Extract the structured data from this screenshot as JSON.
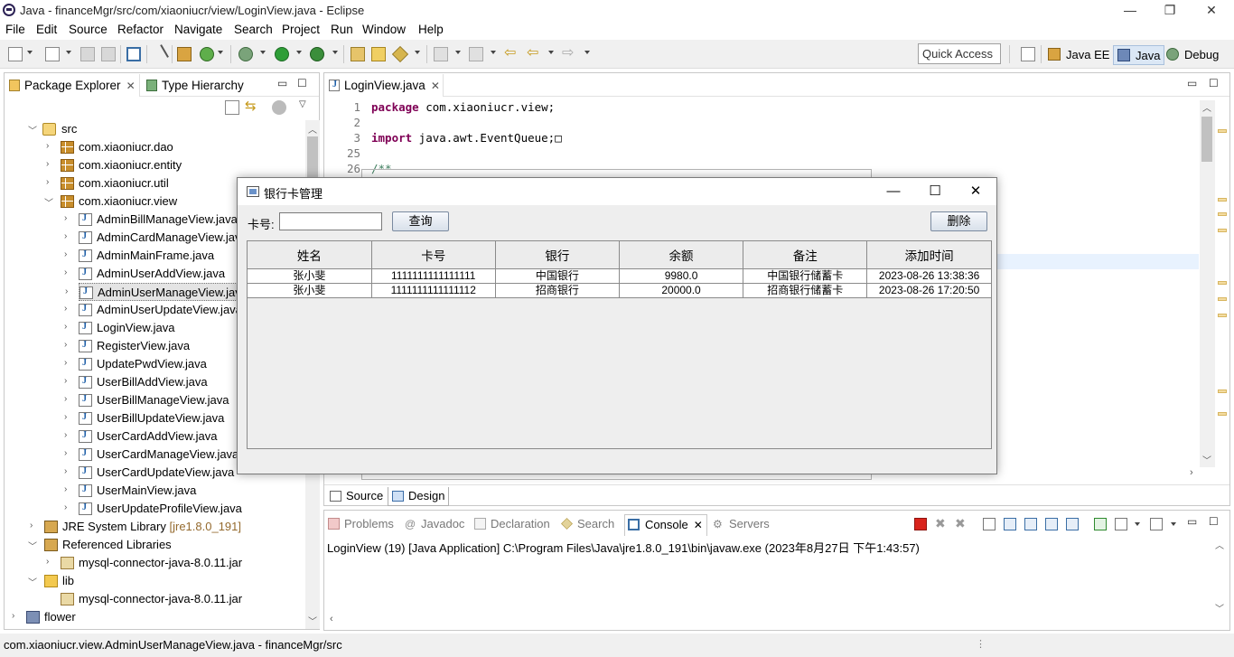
{
  "window": {
    "title": "Java - financeMgr/src/com/xiaoniucr/view/LoginView.java - Eclipse",
    "controls": {
      "minimize": "—",
      "restore": "❐",
      "close": "✕"
    }
  },
  "menu": [
    "File",
    "Edit",
    "Source",
    "Refactor",
    "Navigate",
    "Search",
    "Project",
    "Run",
    "Window",
    "Help"
  ],
  "toolbar": {
    "quick_access": "Quick Access",
    "perspectives": [
      "Java EE",
      "Java",
      "Debug"
    ],
    "active_perspective": "Java"
  },
  "package_explorer": {
    "tab_label": "Package Explorer",
    "tab2_label": "Type Hierarchy",
    "tree": [
      {
        "label": "src",
        "icon": "source-folder-icon",
        "expanded": true
      },
      {
        "label": "com.xiaoniucr.dao",
        "icon": "package-icon"
      },
      {
        "label": "com.xiaoniucr.entity",
        "icon": "package-icon"
      },
      {
        "label": "com.xiaoniucr.util",
        "icon": "package-icon"
      },
      {
        "label": "com.xiaoniucr.view",
        "icon": "package-icon",
        "expanded": true
      },
      {
        "label": "AdminBillManageView.java",
        "icon": "java-file-icon"
      },
      {
        "label": "AdminCardManageView.java",
        "icon": "java-file-icon"
      },
      {
        "label": "AdminMainFrame.java",
        "icon": "java-file-icon"
      },
      {
        "label": "AdminUserAddView.java",
        "icon": "java-file-icon"
      },
      {
        "label": "AdminUserManageView.java",
        "icon": "java-file-icon",
        "selected": true
      },
      {
        "label": "AdminUserUpdateView.java",
        "icon": "java-file-icon"
      },
      {
        "label": "LoginView.java",
        "icon": "java-file-icon"
      },
      {
        "label": "RegisterView.java",
        "icon": "java-file-icon"
      },
      {
        "label": "UpdatePwdView.java",
        "icon": "java-file-icon"
      },
      {
        "label": "UserBillAddView.java",
        "icon": "java-file-icon"
      },
      {
        "label": "UserBillManageView.java",
        "icon": "java-file-icon"
      },
      {
        "label": "UserBillUpdateView.java",
        "icon": "java-file-icon"
      },
      {
        "label": "UserCardAddView.java",
        "icon": "java-file-icon"
      },
      {
        "label": "UserCardManageView.java",
        "icon": "java-file-icon"
      },
      {
        "label": "UserCardUpdateView.java",
        "icon": "java-file-icon"
      },
      {
        "label": "UserMainView.java",
        "icon": "java-file-icon"
      },
      {
        "label": "UserUpdateProfileView.java",
        "icon": "java-file-icon"
      },
      {
        "label": "JRE System Library",
        "suffix": "[jre1.8.0_191]",
        "icon": "library-icon"
      },
      {
        "label": "Referenced Libraries",
        "icon": "library-icon",
        "expanded": true
      },
      {
        "label": "mysql-connector-java-8.0.11.jar",
        "icon": "jar-icon"
      },
      {
        "label": "lib",
        "icon": "folder-icon",
        "expanded": true
      },
      {
        "label": "mysql-connector-java-8.0.11.jar",
        "icon": "jar-icon"
      },
      {
        "label": "flower",
        "icon": "project-icon"
      }
    ]
  },
  "editor": {
    "tab_label": "LoginView.java",
    "lines": [
      {
        "num": "1",
        "parts": [
          [
            "kw",
            "package"
          ],
          [
            "",
            " com.xiaoniucr.view;"
          ]
        ]
      },
      {
        "num": "2",
        "parts": []
      },
      {
        "num": "3",
        "parts": [
          [
            "kw",
            "import"
          ],
          [
            "",
            " java.awt.EventQueue;□"
          ]
        ]
      },
      {
        "num": "25",
        "parts": []
      },
      {
        "num": "26",
        "parts": [
          [
            "cm",
            "/**"
          ]
        ]
      }
    ],
    "bottom_tabs": [
      "Source",
      "Design"
    ],
    "active_bottom_tab": "Design"
  },
  "dialog": {
    "title": "银行卡管理",
    "card_label": "卡号:",
    "card_value": "",
    "query_button": "查询",
    "delete_button": "删除",
    "columns": [
      "姓名",
      "卡号",
      "银行",
      "余额",
      "备注",
      "添加时间"
    ],
    "rows": [
      [
        "张小斐",
        "1111111111111111",
        "中国银行",
        "9980.0",
        "中国银行储蓄卡",
        "2023-08-26 13:38:36"
      ],
      [
        "张小斐",
        "1111111111111112",
        "招商银行",
        "20000.0",
        "招商银行储蓄卡",
        "2023-08-26 17:20:50"
      ]
    ]
  },
  "console": {
    "tabs": [
      "Problems",
      "Javadoc",
      "Declaration",
      "Search",
      "Console",
      "Servers"
    ],
    "active_tab": "Console",
    "output": "LoginView (19) [Java Application] C:\\Program Files\\Java\\jre1.8.0_191\\bin\\javaw.exe (2023年8月27日 下午1:43:57)"
  },
  "status": "com.xiaoniucr.view.AdminUserManageView.java - financeMgr/src",
  "colors": {
    "toolbar_bg": "#f0f0f0",
    "selection": "#e4e4e4",
    "keyword": "#7f0055",
    "comment": "#3f7f5f"
  }
}
